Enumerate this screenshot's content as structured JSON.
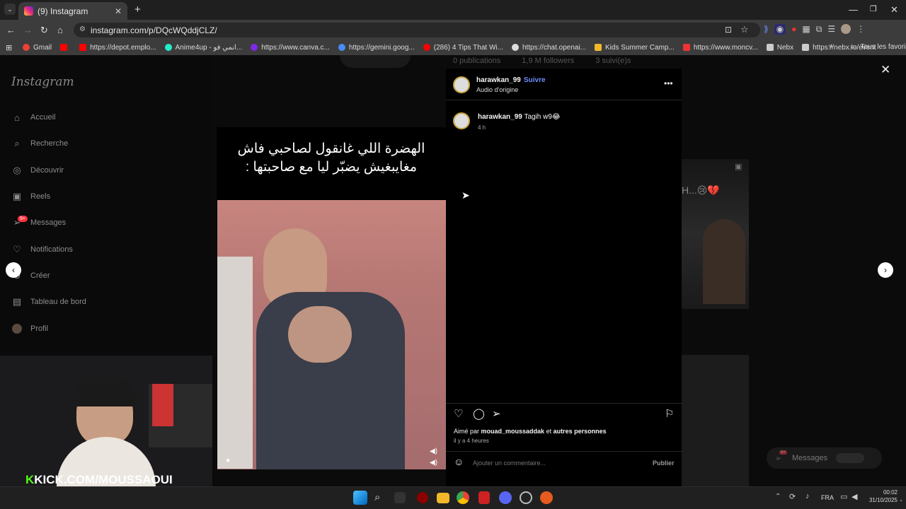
{
  "browser": {
    "tab_title": "(9) Instagram",
    "url": "instagram.com/p/DQcWQddjCLZ/",
    "bookmarks": [
      "Gmail",
      "https://depot.emplo...",
      "Anime4up - انمي فو...",
      "https://www.canva.c...",
      "https://gemini.goog...",
      "(286) 4 Tips That Wi...",
      "https://chat.openai...",
      "Kids Summer Camp...",
      "https://www.moncv...",
      "Nebx",
      "https://nebx.io/event"
    ],
    "all_bookmarks": "Tous les favoris"
  },
  "sidebar": {
    "logo": "Instagram",
    "items": [
      {
        "label": "Accueil",
        "icon": "home-icon"
      },
      {
        "label": "Recherche",
        "icon": "search-icon"
      },
      {
        "label": "Découvrir",
        "icon": "compass-icon"
      },
      {
        "label": "Reels",
        "icon": "reels-icon"
      },
      {
        "label": "Messages",
        "icon": "messenger-icon"
      },
      {
        "label": "Notifications",
        "icon": "heart-icon"
      },
      {
        "label": "Créer",
        "icon": "plus-icon"
      },
      {
        "label": "Tableau de bord",
        "icon": "dashboard-icon"
      },
      {
        "label": "Profil",
        "icon": "avatar-icon"
      }
    ],
    "messages_badge": "9+"
  },
  "profile_bg": {
    "publications": "0 publications",
    "followers": "1,9 M followers",
    "following": "3 suivi(e)s"
  },
  "video": {
    "caption": "الهضرة اللي غانقول لصاحبي فاش مغايبغيش يضبّر ليا مع صاحبتها :"
  },
  "panel": {
    "username": "harawkan_99",
    "dot": "•",
    "follow": "Suivre",
    "audio": "Audio d'origine",
    "comment_user": "harawkan_99",
    "comment_text": "Tagih w9😂",
    "comment_time": "4 h",
    "liked_prefix": "Aimé par",
    "liked_user": "mouad_moussaddak",
    "liked_and": "et",
    "liked_others": "autres personnes",
    "post_time": "il y a 4 heures",
    "comment_placeholder": "Ajouter un commentaire...",
    "publish": "Publier"
  },
  "bg_reel_text": "H...😢💔",
  "messages_pill": "Messages",
  "messages_pill_badge": "9+",
  "stream": {
    "kick_prefix": "K",
    "kick_label": "KICK.COM/MOUSSAOUI"
  },
  "taskbar": {
    "lang": "FRA",
    "time": "00:02",
    "date": "31/10/2025"
  }
}
